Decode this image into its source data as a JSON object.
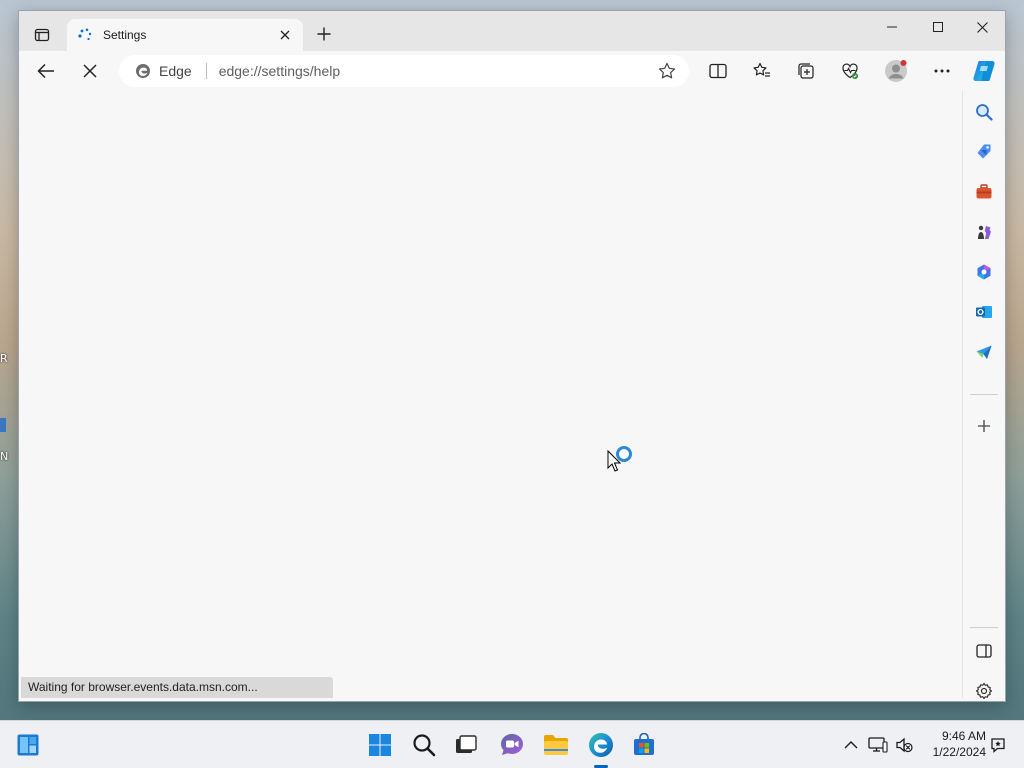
{
  "desktop": {
    "fragments": [
      "R",
      "N"
    ]
  },
  "browser": {
    "tab": {
      "title": "Settings",
      "favicon": "loading-dots-icon"
    },
    "window_controls": [
      "minimize-icon",
      "maximize-icon",
      "close-icon"
    ],
    "omnibox": {
      "brand": "Edge",
      "url": "edge://settings/help"
    },
    "toolbar_icons": [
      "back-arrow-icon",
      "stop-loading-icon",
      "split-screen-icon",
      "favorites-icon",
      "collections-icon",
      "browser-essentials-icon",
      "profile-avatar-icon",
      "more-menu-icon",
      "copilot-icon"
    ],
    "sidebar_icons": [
      "search-icon",
      "shopping-tag-icon",
      "tools-icon",
      "games-icon",
      "microsoft-365-icon",
      "outlook-icon",
      "drop-icon",
      "add-icon",
      "hide-sidebar-icon",
      "settings-gear-icon"
    ],
    "status": "Waiting for browser.events.data.msn.com..."
  },
  "taskbar": {
    "apps": [
      "start-icon",
      "search-icon",
      "task-view-icon",
      "teams-chat-icon",
      "file-explorer-icon",
      "edge-icon",
      "store-icon"
    ],
    "tray": [
      "show-hidden-icons-chevron",
      "network-icon",
      "volume-muted-icon",
      "notification-icon"
    ],
    "time": "9:46 AM",
    "date": "1/22/2024"
  },
  "colors": {
    "accent": "#0067c0",
    "spinner": "#2b88d8"
  }
}
